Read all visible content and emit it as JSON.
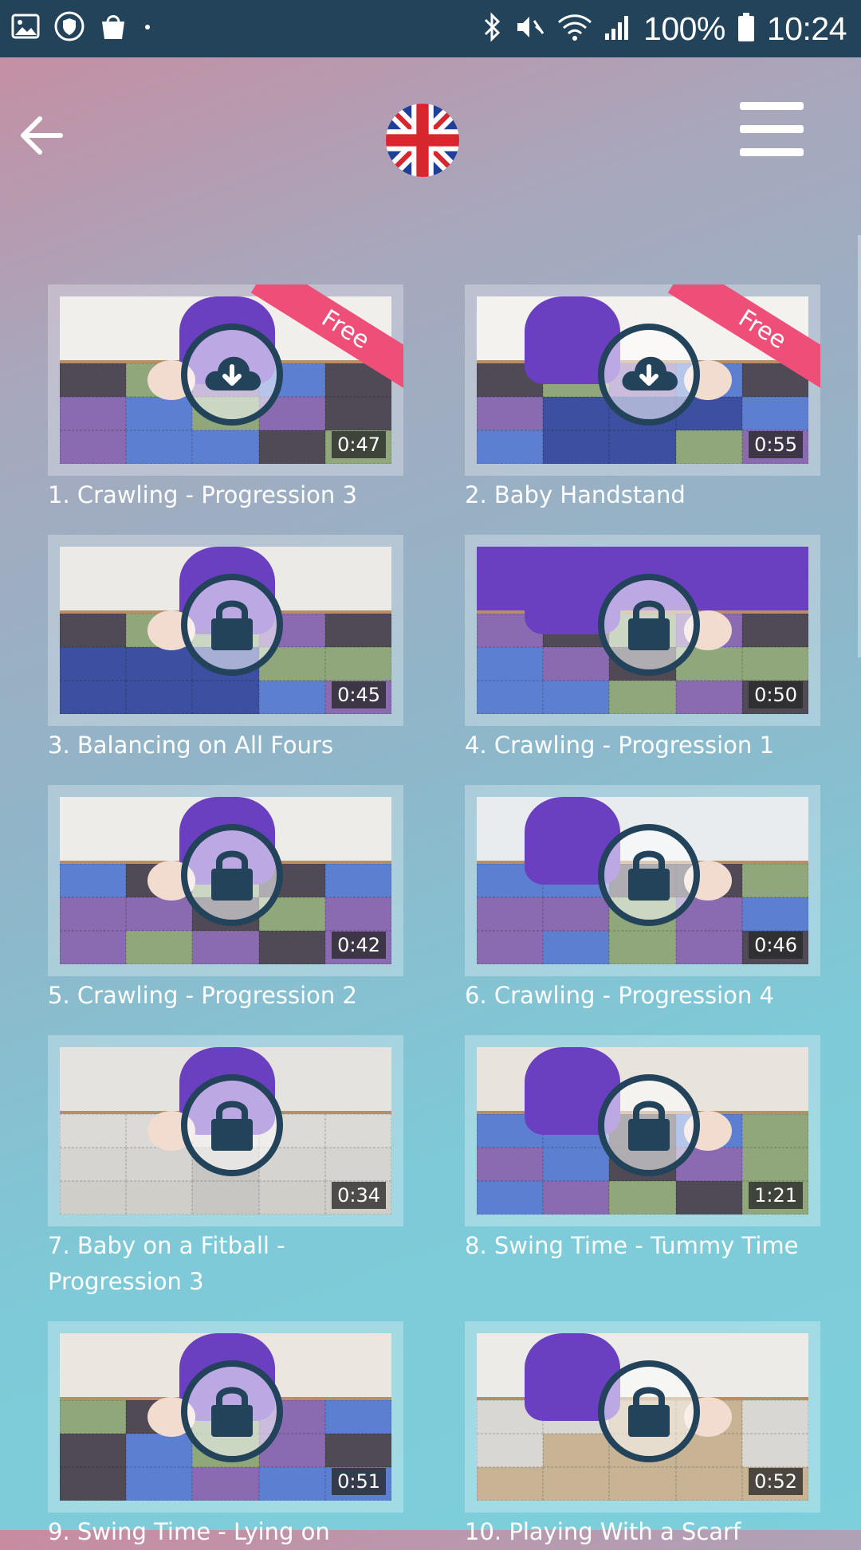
{
  "status_bar": {
    "battery": "100%",
    "time": "10:24",
    "icons": [
      "image-icon",
      "shield-icon",
      "shopping-bag-icon",
      "dot-icon",
      "bluetooth-icon",
      "mute-icon",
      "wifi-icon",
      "signal-icon",
      "battery-icon"
    ]
  },
  "header": {
    "back_icon": "arrow-left-icon",
    "flag": "uk-flag-icon",
    "menu_icon": "hamburger-menu-icon"
  },
  "videos": [
    {
      "title": "1. Crawling - Progression 3",
      "duration": "0:47",
      "badge": "Free",
      "status": "download",
      "scene": {
        "wall": "#f1efeb",
        "mat": [
          "#4f4a56",
          "#8fa77a",
          "#8a6ab0",
          "#5d7fd1",
          "#4f4a56",
          "#8a6ab0",
          "#5d7fd1",
          "#8fa77a",
          "#8a6ab0",
          "#4f4a56",
          "#8a6ab0",
          "#5d7fd1",
          "#5d7fd1",
          "#4f4a56",
          "#8fa77a"
        ]
      }
    },
    {
      "title": "2. Baby Handstand",
      "duration": "0:55",
      "badge": "Free",
      "status": "download",
      "scene": {
        "wall": "#f3f2ef",
        "mat": [
          "#4f4a56",
          "#8fa77a",
          "#8a6ab0",
          "#5d7fd1",
          "#4f4a56",
          "#8a6ab0",
          "#3d4fa0",
          "#3d4fa0",
          "#3d4fa0",
          "#5d7fd1",
          "#5d7fd1",
          "#3d4fa0",
          "#3d4fa0",
          "#8fa77a",
          "#8a6ab0"
        ]
      }
    },
    {
      "title": "3. Balancing on All Fours",
      "duration": "0:45",
      "badge": "",
      "status": "locked",
      "scene": {
        "wall": "#eceae6",
        "mat": [
          "#4f4a56",
          "#8fa77a",
          "#8fa77a",
          "#8a6ab0",
          "#4f4a56",
          "#3d4fa0",
          "#3d4fa0",
          "#3d4fa0",
          "#8fa77a",
          "#8fa77a",
          "#3d4fa0",
          "#3d4fa0",
          "#3d4fa0",
          "#5d7fd1",
          "#8a6ab0"
        ]
      }
    },
    {
      "title": "4. Crawling - Progression 1",
      "duration": "0:50",
      "badge": "",
      "status": "locked",
      "scene": {
        "wall": "#6a3fc0",
        "mat": [
          "#8a6ab0",
          "#4f4a56",
          "#8fa77a",
          "#8a6ab0",
          "#4f4a56",
          "#5d7fd1",
          "#8a6ab0",
          "#4f4a56",
          "#8fa77a",
          "#8fa77a",
          "#5d7fd1",
          "#5d7fd1",
          "#8fa77a",
          "#8a6ab0",
          "#4f4a56"
        ]
      }
    },
    {
      "title": "5. Crawling - Progression 2",
      "duration": "0:42",
      "badge": "",
      "status": "locked",
      "scene": {
        "wall": "#eeece8",
        "mat": [
          "#5d7fd1",
          "#4f4a56",
          "#8fa77a",
          "#4f4a56",
          "#5d7fd1",
          "#8a6ab0",
          "#8a6ab0",
          "#4f4a56",
          "#8fa77a",
          "#8a6ab0",
          "#8a6ab0",
          "#8fa77a",
          "#8a6ab0",
          "#4f4a56",
          "#8a6ab0"
        ]
      }
    },
    {
      "title": "6. Crawling - Progression 4",
      "duration": "0:46",
      "badge": "",
      "status": "locked",
      "scene": {
        "wall": "#e9ecef",
        "mat": [
          "#5d7fd1",
          "#5d7fd1",
          "#4f4a56",
          "#4f4a56",
          "#8fa77a",
          "#8a6ab0",
          "#8a6ab0",
          "#8fa77a",
          "#8a6ab0",
          "#5d7fd1",
          "#8a6ab0",
          "#5d7fd1",
          "#8fa77a",
          "#8a6ab0",
          "#4f4a56"
        ]
      }
    },
    {
      "title": "7. Baby on a Fitball - Progression 3",
      "duration": "0:34",
      "badge": "",
      "status": "locked",
      "scene": {
        "wall": "#e5e3df",
        "mat": [
          "#dcdad6",
          "#dcdad6",
          "#dcdad6",
          "#dcdad6",
          "#dcdad6",
          "#d6d4d0",
          "#d6d4d0",
          "#c8c6c2",
          "#d6d4d0",
          "#d6d4d0",
          "#d0cec9",
          "#d0cec9",
          "#c8c6c2",
          "#d0cec9",
          "#d0cec9"
        ]
      }
    },
    {
      "title": "8. Swing Time - Tummy Time",
      "duration": "1:21",
      "badge": "",
      "status": "locked",
      "scene": {
        "wall": "#e8e4dd",
        "mat": [
          "#5d7fd1",
          "#5d7fd1",
          "#4f4a56",
          "#5d7fd1",
          "#8fa77a",
          "#8a6ab0",
          "#5d7fd1",
          "#4f4a56",
          "#8a6ab0",
          "#8fa77a",
          "#5d7fd1",
          "#8a6ab0",
          "#8fa77a",
          "#4f4a56",
          "#8fa77a"
        ]
      }
    },
    {
      "title": "9. Swing Time - Lying on",
      "duration": "0:51",
      "badge": "",
      "status": "locked",
      "scene": {
        "wall": "#ebe7e0",
        "mat": [
          "#8fa77a",
          "#4f4a56",
          "#8fa77a",
          "#8a6ab0",
          "#5d7fd1",
          "#4f4a56",
          "#5d7fd1",
          "#8fa77a",
          "#8a6ab0",
          "#4f4a56",
          "#4f4a56",
          "#5d7fd1",
          "#8a6ab0",
          "#5d7fd1",
          "#5d7fd1"
        ]
      }
    },
    {
      "title": "10. Playing With a Scarf",
      "duration": "0:52",
      "badge": "",
      "status": "locked",
      "scene": {
        "wall": "#ecebe8",
        "mat": [
          "#d9d7d3",
          "#d9d7d3",
          "#c9b395",
          "#c9b395",
          "#d9d7d3",
          "#d9d7d3",
          "#c9b395",
          "#c9b395",
          "#c9b395",
          "#d9d7d3",
          "#c9b395",
          "#c9b395",
          "#c9b395",
          "#c9b395",
          "#c9b395"
        ]
      }
    }
  ]
}
